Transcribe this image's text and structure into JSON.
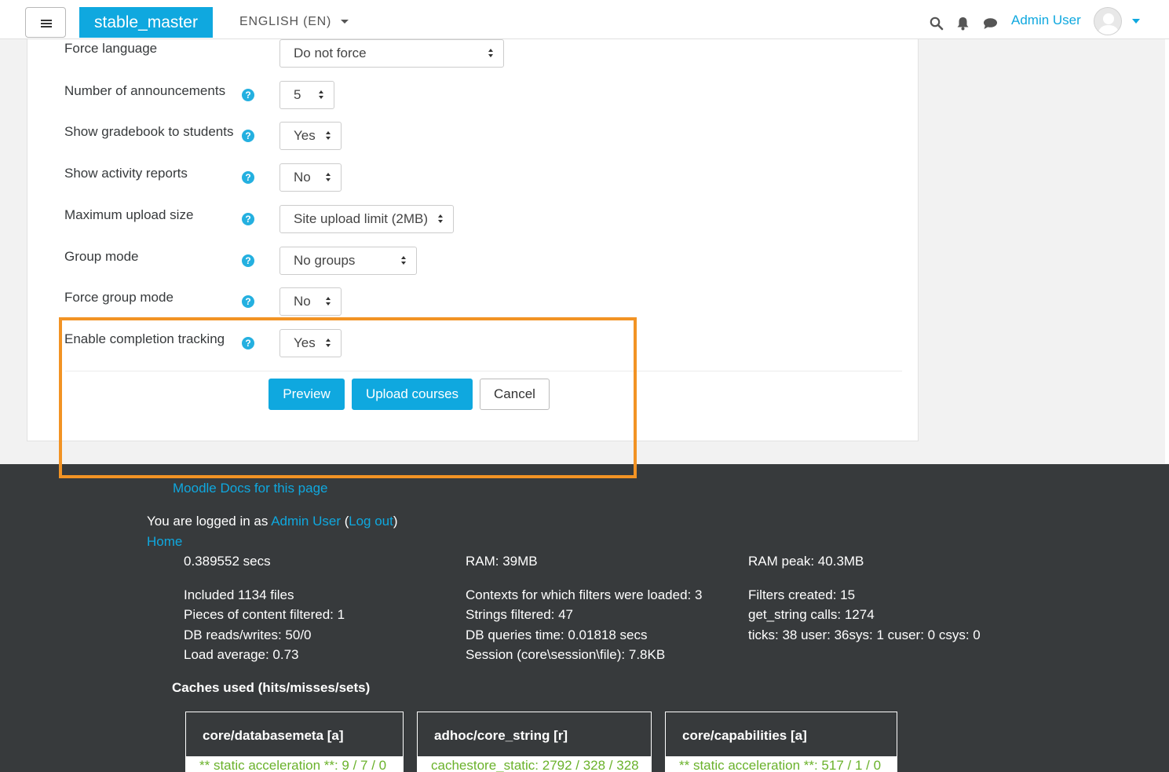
{
  "navbar": {
    "brand": "stable_master",
    "language": "ENGLISH (EN)",
    "user_name": "Admin User"
  },
  "form": {
    "rows": [
      {
        "label": "Force language",
        "value": "Do not force",
        "has_help": false
      },
      {
        "label": "Number of announcements",
        "value": "5",
        "has_help": true
      },
      {
        "label": "Show gradebook to students",
        "value": "Yes",
        "has_help": true
      },
      {
        "label": "Show activity reports",
        "value": "No",
        "has_help": true
      },
      {
        "label": "Maximum upload size",
        "value": "Site upload limit (2MB)",
        "has_help": true
      },
      {
        "label": "Group mode",
        "value": "No groups",
        "has_help": true
      },
      {
        "label": "Force group mode",
        "value": "No",
        "has_help": true
      },
      {
        "label": "Enable completion tracking",
        "value": "Yes",
        "has_help": true
      }
    ],
    "help_glyph": "?",
    "buttons": {
      "preview": "Preview",
      "upload": "Upload courses",
      "cancel": "Cancel"
    }
  },
  "footer": {
    "docs_link": "Moodle Docs for this page",
    "logged_in_prefix": "You are logged in as",
    "logged_in_user": "Admin User",
    "paren_open": "(",
    "logout": "Log out",
    "paren_close": ")",
    "home": "Home",
    "perf": {
      "col1": [
        "0.389552 secs",
        "Included 1134 files",
        "Pieces of content filtered: 1",
        "DB reads/writes: 50/0",
        "Load average: 0.73"
      ],
      "col2": [
        "RAM: 39MB",
        "Contexts for which filters were loaded: 3",
        "Strings filtered: 47",
        "DB queries time: 0.01818 secs",
        "Session (core\\session\\file): 7.8KB"
      ],
      "col3": [
        "RAM peak: 40.3MB",
        "Filters created: 15",
        "get_string calls: 1274",
        "ticks: 38 user: 36sys: 1 cuser: 0 csys: 0"
      ]
    },
    "caches_title": "Caches used (hits/misses/sets)",
    "caches": [
      {
        "name": "core/databasemeta [a]",
        "line": "** static acceleration **: 9 / 7 / 0"
      },
      {
        "name": "adhoc/core_string [r]",
        "line": "cachestore_static: 2792 / 328 / 328"
      },
      {
        "name": "core/capabilities [a]",
        "line": "** static acceleration **: 517 / 1 / 0"
      }
    ]
  },
  "colors": {
    "accent": "#0fa8df",
    "highlight": "#f29324",
    "footer_bg": "#373a3c",
    "cache_text": "#6ab22b"
  }
}
